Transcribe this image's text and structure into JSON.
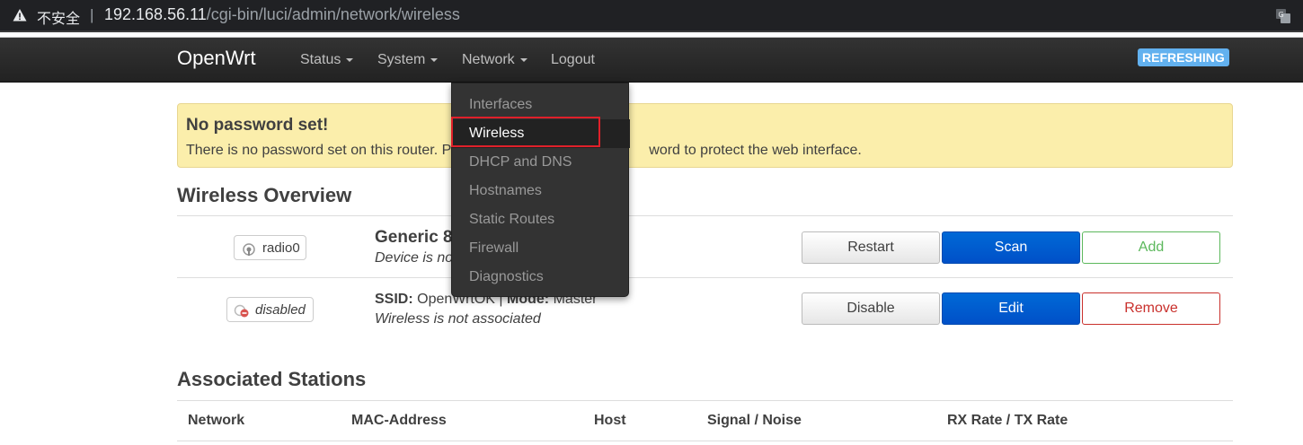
{
  "browser": {
    "security_label": "不安全",
    "separator": "|",
    "url_host": "192.168.56.11",
    "url_path": "/cgi-bin/luci/admin/network/wireless"
  },
  "navbar": {
    "brand": "OpenWrt",
    "items": [
      {
        "label": "Status",
        "has_caret": true
      },
      {
        "label": "System",
        "has_caret": true
      },
      {
        "label": "Network",
        "has_caret": true
      },
      {
        "label": "Logout",
        "has_caret": false
      }
    ],
    "status_badge": "REFRESHING"
  },
  "dropdown": {
    "items": [
      {
        "label": "Interfaces",
        "active": false
      },
      {
        "label": "Wireless",
        "active": true
      },
      {
        "label": "DHCP and DNS",
        "active": false
      },
      {
        "label": "Hostnames",
        "active": false
      },
      {
        "label": "Static Routes",
        "active": false
      },
      {
        "label": "Firewall",
        "active": false
      },
      {
        "label": "Diagnostics",
        "active": false
      }
    ]
  },
  "alert": {
    "title": "No password set!",
    "text_before": "There is no password set on this router. P",
    "text_after": "word to protect the web interface."
  },
  "overview": {
    "title": "Wireless Overview",
    "radio": {
      "badge": "radio0",
      "device_title": "Generic 8",
      "device_subtitle": "Device is no",
      "buttons": {
        "restart": "Restart",
        "scan": "Scan",
        "add": "Add"
      }
    },
    "network": {
      "badge": "disabled",
      "ssid_label": "SSID:",
      "ssid_value": "OpenWrtOK",
      "mode_sep": "|",
      "mode_label": "Mode:",
      "mode_value": "Master",
      "association": "Wireless is not associated",
      "buttons": {
        "disable": "Disable",
        "edit": "Edit",
        "remove": "Remove"
      }
    }
  },
  "stations": {
    "title": "Associated Stations",
    "columns": [
      "Network",
      "MAC-Address",
      "Host",
      "Signal / Noise",
      "RX Rate / TX Rate"
    ]
  },
  "colors": {
    "navbar_bg": "#222222",
    "primary_button": "#0069d6",
    "add_button": "#5cb85c",
    "remove_button": "#c9302c",
    "alert_bg": "#fbeeab",
    "refreshing_badge": "#62b1ef",
    "highlight_box": "#e0202a"
  },
  "icons": {
    "security": "warning-triangle-icon",
    "translate": "translate-icon",
    "radio": "wifi-radio-icon",
    "disabled": "wifi-disabled-icon"
  }
}
